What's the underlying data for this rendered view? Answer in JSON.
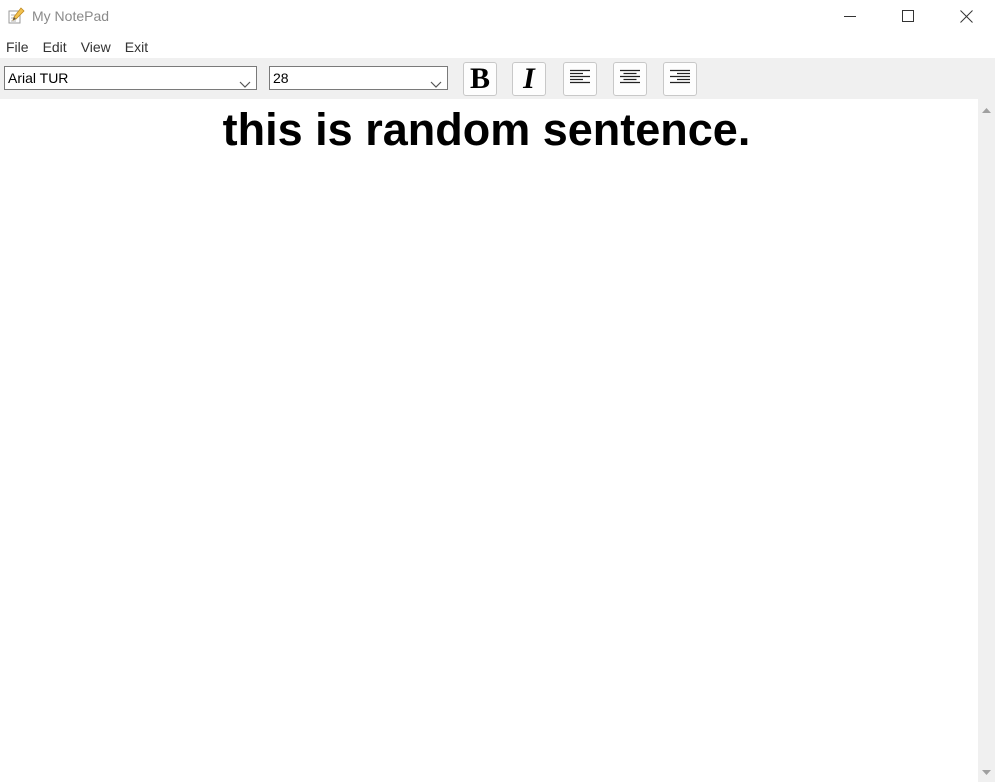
{
  "window": {
    "title": "My NotePad"
  },
  "menu": {
    "items": [
      "File",
      "Edit",
      "View",
      "Exit"
    ]
  },
  "toolbar": {
    "font_value": "Arial TUR",
    "size_value": "28",
    "bold_label": "B",
    "italic_label": "I"
  },
  "editor": {
    "text": "this is random sentence.",
    "alignment": "center",
    "bold": true
  },
  "icons": {
    "app": "notepad-pencil-icon",
    "minimize": "minimize-icon",
    "maximize": "maximize-icon",
    "close": "close-icon",
    "dropdown": "chevron-down-icon",
    "align_left": "align-left-icon",
    "align_center": "align-center-icon",
    "align_right": "align-right-icon",
    "scroll_up": "scroll-up-arrow-icon",
    "scroll_down": "scroll-down-arrow-icon"
  },
  "colors": {
    "toolbar_bg": "#f0f0f0",
    "title_text": "#8a8a8a",
    "text": "#000000"
  }
}
